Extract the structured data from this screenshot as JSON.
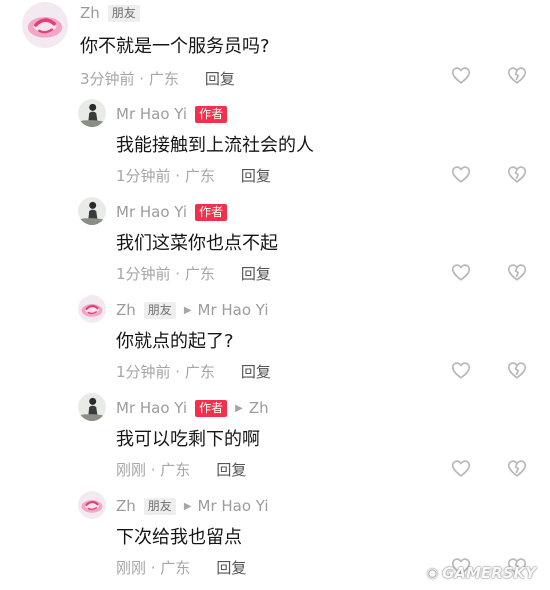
{
  "comments": [
    {
      "user": "Zh",
      "tag": "朋友",
      "text": "你不就是一个服务员吗?",
      "time": "3分钟前 · 广东",
      "reply": "回复"
    },
    {
      "user": "Mr Hao Yi",
      "tag": "作者",
      "text": "我能接触到上流社会的人",
      "time": "1分钟前 · 广东",
      "reply": "回复"
    },
    {
      "user": "Mr Hao Yi",
      "tag": "作者",
      "text": "我们这菜你也点不起",
      "time": "1分钟前 · 广东",
      "reply": "回复"
    },
    {
      "user": "Zh",
      "tag": "朋友",
      "reply_to": "Mr Hao Yi",
      "text": "你就点的起了?",
      "time": "1分钟前 · 广东",
      "reply": "回复"
    },
    {
      "user": "Mr Hao Yi",
      "tag": "作者",
      "reply_to": "Zh",
      "text": "我可以吃剩下的啊",
      "time": "刚刚 · 广东",
      "reply": "回复"
    },
    {
      "user": "Zh",
      "tag": "朋友",
      "reply_to": "Mr Hao Yi",
      "text": "下次给我也留点",
      "time": "刚刚 · 广东",
      "reply": "回复"
    }
  ],
  "icons": {
    "like": "heart-outline-icon",
    "dislike": "broken-heart-icon"
  },
  "colors": {
    "author_tag": "#f3304b",
    "friend_tag": "#eeeeee",
    "meta_text": "#9c9c9c"
  },
  "watermark": "GAMERSKY"
}
